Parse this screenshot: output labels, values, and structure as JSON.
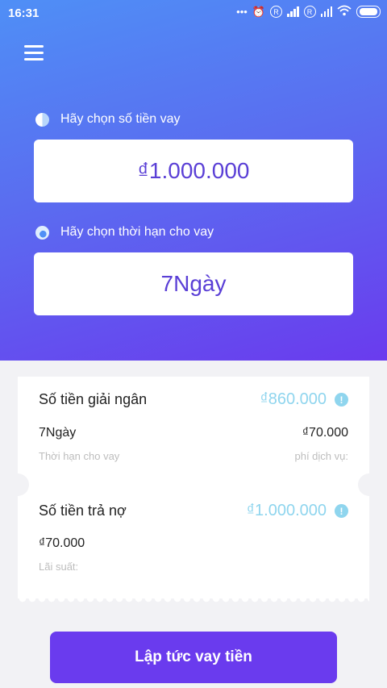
{
  "status_bar": {
    "time": "16:31",
    "icons": [
      "more-dots-icon",
      "alarm-off-icon",
      "sim-1-icon",
      "signal-icon",
      "sim-2-icon",
      "signal-icon",
      "wifi-icon",
      "battery-icon"
    ]
  },
  "header": {
    "menu_icon": "hamburger-menu-icon"
  },
  "loan_amount": {
    "label": "Hãy chọn số tiền vay",
    "value": "₫1.000.000"
  },
  "loan_term": {
    "label": "Hãy chọn thời hạn cho vay",
    "value": "7Ngày"
  },
  "summary": {
    "disbursement_label": "Số tiền giải ngân",
    "disbursement_value": "₫860.000",
    "term_value": "7Ngày",
    "term_caption": "Thời hạn cho vay",
    "service_fee_value": "₫70.000",
    "service_fee_caption": "phí dịch vụ:",
    "repayment_label": "Số tiền trả nợ",
    "repayment_value": "₫1.000.000",
    "interest_value": "₫70.000",
    "interest_caption": "Lãi suất:"
  },
  "cta": {
    "label": "Lập tức vay tiền"
  },
  "colors": {
    "gradient_start": "#4f8ff6",
    "gradient_end": "#6a3bee",
    "accent_purple": "#6a3bee",
    "amount_cyan": "#8fd5ee"
  }
}
